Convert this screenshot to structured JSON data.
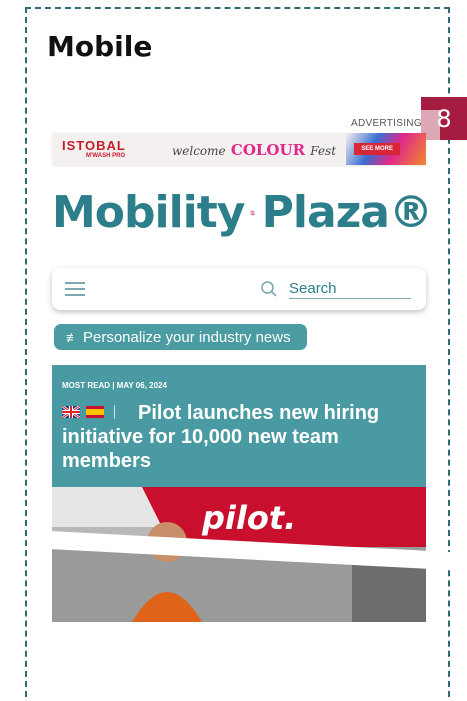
{
  "frame": {
    "title": "Mobile",
    "badge": "8"
  },
  "ad": {
    "label": "ADVERTISING",
    "brand": "ISTOBAL",
    "brand_sub": "M'WASH PRO",
    "tagline_welcome": "welcome",
    "tagline_colour": "COLOUR",
    "tagline_fest": "Fest",
    "cta": "SEE MORE"
  },
  "logo": {
    "left": "Mobility",
    "right": "Plaza®"
  },
  "search": {
    "placeholder": "Search"
  },
  "personalize": {
    "icon": "sliders-icon",
    "label": "Personalize your industry news"
  },
  "news": {
    "meta": "MOST READ | MAY 06, 2024",
    "headline": "Pilot launches new hiring initiative for 10,000 new team members",
    "photo_sign": "pilot."
  },
  "colors": {
    "accent": "#2b7e8a",
    "badge": "#a51c40",
    "card": "#4a9aa3"
  }
}
